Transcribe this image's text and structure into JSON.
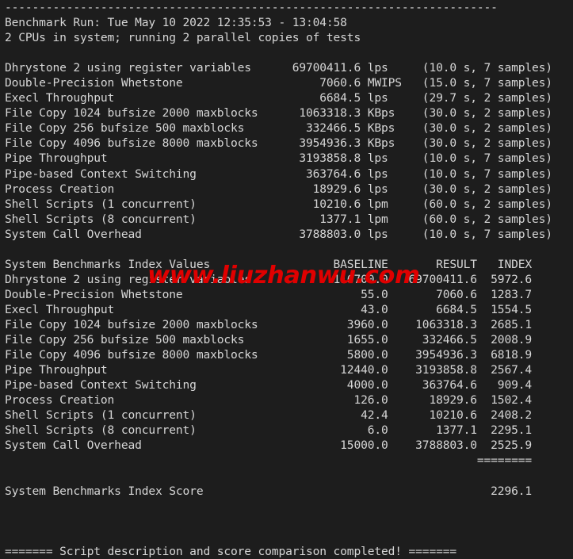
{
  "terminal": {
    "background_color": "#1d1d1d",
    "text_color": "#d6d6d6",
    "watermark_color": "#e00000",
    "watermark_text": "www.liuzhanwu.com",
    "top_rule": "------------------------------------------------------------------------",
    "header": {
      "run_line": "Benchmark Run: Tue May 10 2022 12:35:53 - 13:04:58",
      "cpu_line": "2 CPUs in system; running 2 parallel copies of tests"
    },
    "results": {
      "rows": [
        {
          "name": "Dhrystone 2 using register variables",
          "value": "69700411.6",
          "unit": "lps",
          "detail": "(10.0 s, 7 samples)"
        },
        {
          "name": "Double-Precision Whetstone",
          "value": "7060.6",
          "unit": "MWIPS",
          "detail": "(15.0 s, 7 samples)"
        },
        {
          "name": "Execl Throughput",
          "value": "6684.5",
          "unit": "lps",
          "detail": "(29.7 s, 2 samples)"
        },
        {
          "name": "File Copy 1024 bufsize 2000 maxblocks",
          "value": "1063318.3",
          "unit": "KBps",
          "detail": "(30.0 s, 2 samples)"
        },
        {
          "name": "File Copy 256 bufsize 500 maxblocks",
          "value": "332466.5",
          "unit": "KBps",
          "detail": "(30.0 s, 2 samples)"
        },
        {
          "name": "File Copy 4096 bufsize 8000 maxblocks",
          "value": "3954936.3",
          "unit": "KBps",
          "detail": "(30.0 s, 2 samples)"
        },
        {
          "name": "Pipe Throughput",
          "value": "3193858.8",
          "unit": "lps",
          "detail": "(10.0 s, 7 samples)"
        },
        {
          "name": "Pipe-based Context Switching",
          "value": "363764.6",
          "unit": "lps",
          "detail": "(10.0 s, 7 samples)"
        },
        {
          "name": "Process Creation",
          "value": "18929.6",
          "unit": "lps",
          "detail": "(30.0 s, 2 samples)"
        },
        {
          "name": "Shell Scripts (1 concurrent)",
          "value": "10210.6",
          "unit": "lpm",
          "detail": "(60.0 s, 2 samples)"
        },
        {
          "name": "Shell Scripts (8 concurrent)",
          "value": "1377.1",
          "unit": "lpm",
          "detail": "(60.0 s, 2 samples)"
        },
        {
          "name": "System Call Overhead",
          "value": "3788803.0",
          "unit": "lps",
          "detail": "(10.0 s, 7 samples)"
        }
      ]
    },
    "index_table": {
      "title": "System Benchmarks Index Values",
      "col_baseline": "BASELINE",
      "col_result": "RESULT",
      "col_index": "INDEX",
      "rows": [
        {
          "name": "Dhrystone 2 using register variables",
          "baseline": "116700.0",
          "result": "69700411.6",
          "index": "5972.6"
        },
        {
          "name": "Double-Precision Whetstone",
          "baseline": "55.0",
          "result": "7060.6",
          "index": "1283.7"
        },
        {
          "name": "Execl Throughput",
          "baseline": "43.0",
          "result": "6684.5",
          "index": "1554.5"
        },
        {
          "name": "File Copy 1024 bufsize 2000 maxblocks",
          "baseline": "3960.0",
          "result": "1063318.3",
          "index": "2685.1"
        },
        {
          "name": "File Copy 256 bufsize 500 maxblocks",
          "baseline": "1655.0",
          "result": "332466.5",
          "index": "2008.9"
        },
        {
          "name": "File Copy 4096 bufsize 8000 maxblocks",
          "baseline": "5800.0",
          "result": "3954936.3",
          "index": "6818.9"
        },
        {
          "name": "Pipe Throughput",
          "baseline": "12440.0",
          "result": "3193858.8",
          "index": "2567.4"
        },
        {
          "name": "Pipe-based Context Switching",
          "baseline": "4000.0",
          "result": "363764.6",
          "index": "909.4"
        },
        {
          "name": "Process Creation",
          "baseline": "126.0",
          "result": "18929.6",
          "index": "1502.4"
        },
        {
          "name": "Shell Scripts (1 concurrent)",
          "baseline": "42.4",
          "result": "10210.6",
          "index": "2408.2"
        },
        {
          "name": "Shell Scripts (8 concurrent)",
          "baseline": "6.0",
          "result": "1377.1",
          "index": "2295.1"
        },
        {
          "name": "System Call Overhead",
          "baseline": "15000.0",
          "result": "3788803.0",
          "index": "2525.9"
        }
      ],
      "rule": "========",
      "score_label": "System Benchmarks Index Score",
      "score_value": "2296.1"
    },
    "footer": "======= Script description and score comparison completed! ======="
  }
}
